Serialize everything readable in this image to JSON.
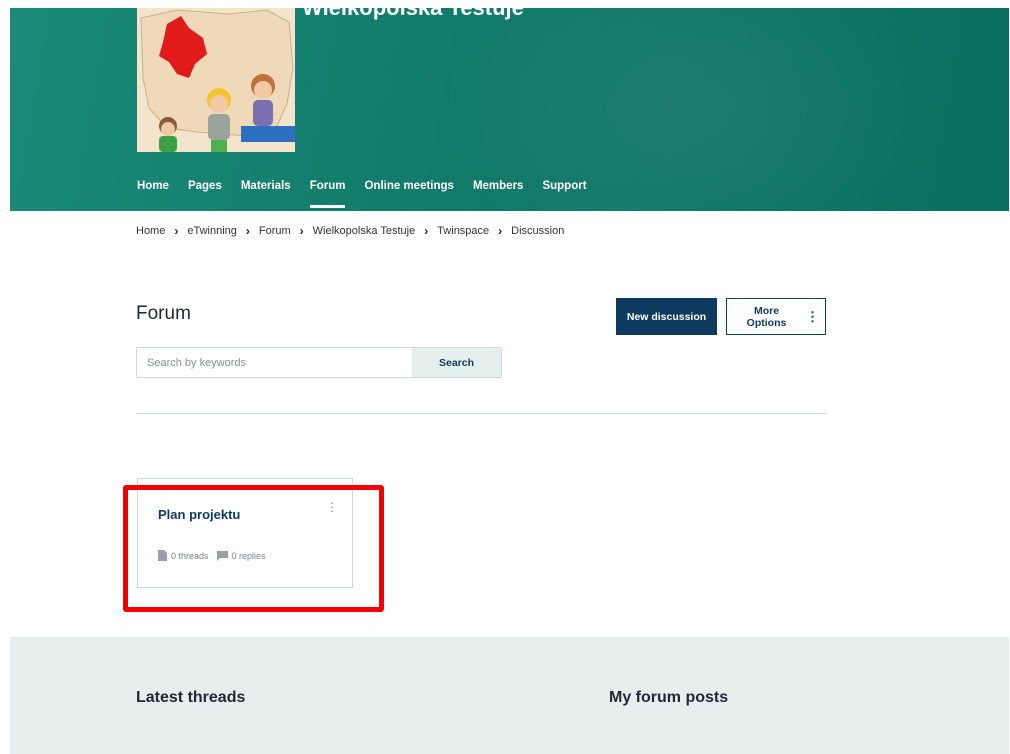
{
  "header": {
    "project_title": "Wielkopolska Testuje",
    "image_alt": "project-image",
    "colors": {
      "hero": "#117a69",
      "primary": "#0e3a5f",
      "highlight": "#f40000"
    }
  },
  "nav": {
    "items": [
      {
        "label": "Home"
      },
      {
        "label": "Pages"
      },
      {
        "label": "Materials"
      },
      {
        "label": "Forum",
        "active": true
      },
      {
        "label": "Online meetings"
      },
      {
        "label": "Members"
      },
      {
        "label": "Support"
      }
    ]
  },
  "breadcrumb": [
    {
      "label": "Home"
    },
    {
      "label": "eTwinning"
    },
    {
      "label": "Forum"
    },
    {
      "label": "Wielkopolska Testuje"
    },
    {
      "label": "Twinspace"
    },
    {
      "label": "Discussion"
    }
  ],
  "main": {
    "title": "Forum",
    "new_discussion_label": "New discussion",
    "more_options_label": "More Options",
    "search": {
      "placeholder": "Search by keywords",
      "value": "",
      "button_label": "Search"
    }
  },
  "forums": [
    {
      "title": "Plan projektu",
      "threads": "0 threads",
      "replies": "0 replies"
    }
  ],
  "footer": {
    "latest_threads": "Latest threads",
    "my_forum_posts": "My forum posts"
  }
}
